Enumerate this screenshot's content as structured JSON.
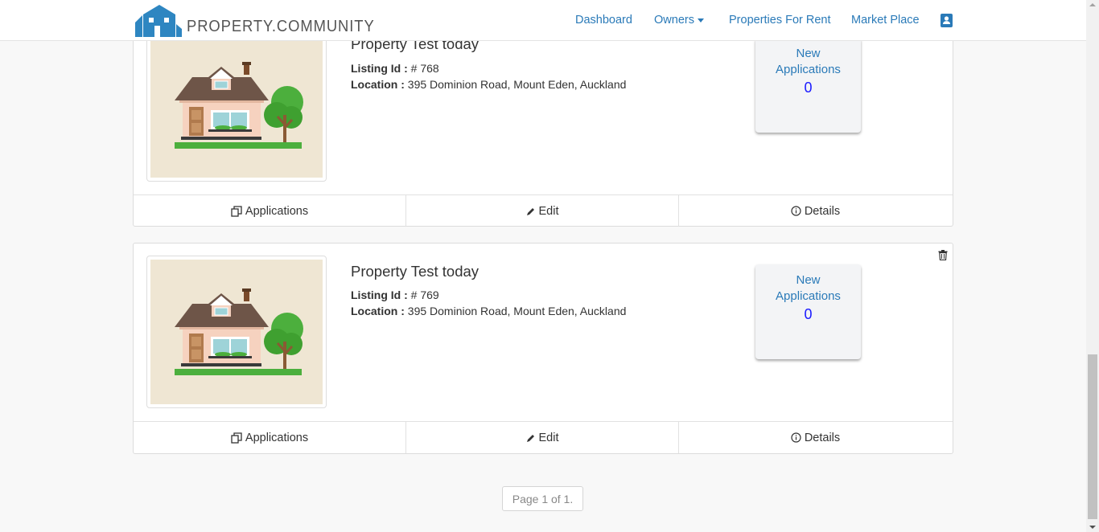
{
  "brand": {
    "name": "PROPERTY.COMMUNITY",
    "color": "#2a7ab8"
  },
  "nav": {
    "dashboard": "Dashboard",
    "owners": "Owners",
    "properties_for_rent": "Properties For Rent",
    "market_place": "Market Place",
    "profile_icon": "contact-card-icon"
  },
  "listings": [
    {
      "title": "Property Test today",
      "listing_id_label": "Listing Id :",
      "listing_id": "# 768",
      "location_label": "Location :",
      "location": "395 Dominion Road, Mount Eden, Auckland",
      "new_label_1": "New",
      "new_label_2": "Applications",
      "new_count": "0",
      "actions": {
        "applications": "Applications",
        "edit": "Edit",
        "details": "Details"
      }
    },
    {
      "title": "Property Test today",
      "listing_id_label": "Listing Id :",
      "listing_id": "# 769",
      "location_label": "Location :",
      "location": "395 Dominion Road, Mount Eden, Auckland",
      "new_label_1": "New",
      "new_label_2": "Applications",
      "new_count": "0",
      "actions": {
        "applications": "Applications",
        "edit": "Edit",
        "details": "Details"
      }
    }
  ],
  "pagination": {
    "text": "Page 1 of 1."
  }
}
